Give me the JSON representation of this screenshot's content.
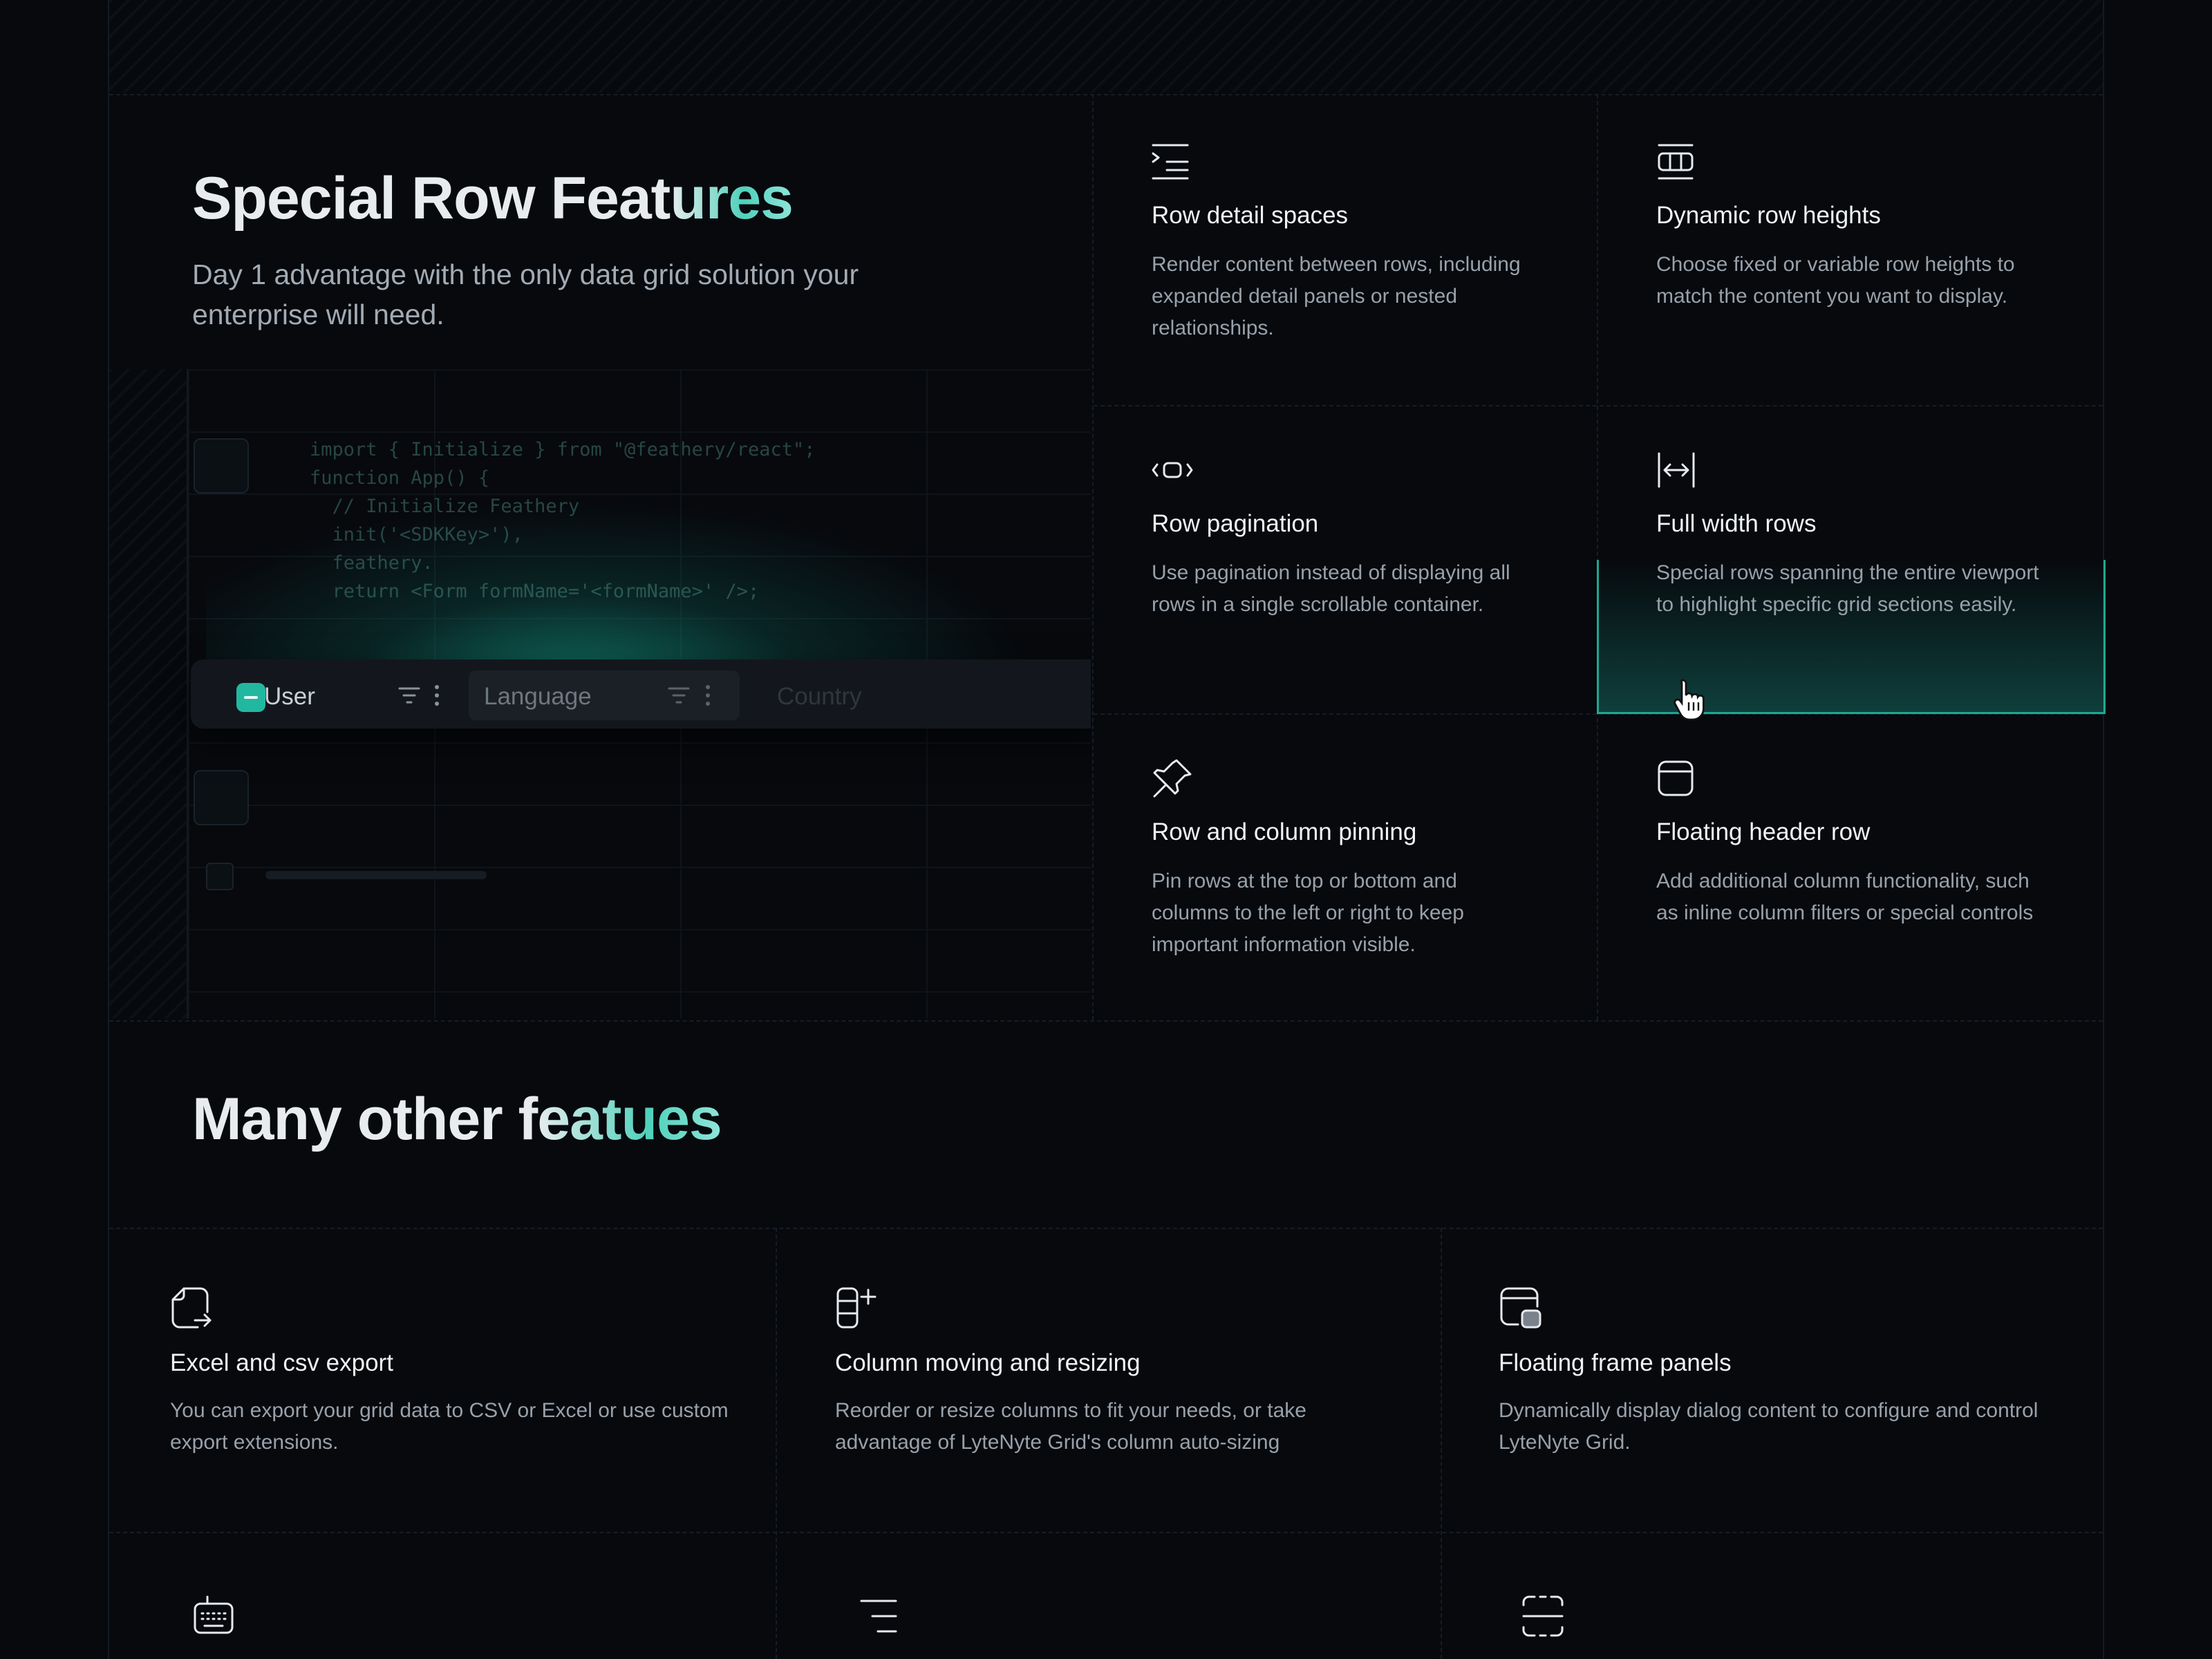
{
  "special": {
    "title_plain": "Special Row Feat",
    "title_accent": "ures",
    "subtitle": "Day 1 advantage with the only data grid solution your enterprise will need."
  },
  "demo": {
    "code_lines": [
      "import { Initialize } from \"@feathery/react\";",
      "",
      "function App() {",
      "  // Initialize Feathery",
      "  init('<SDKKey>'),",
      "  feathery.",
      "  return <Form formName='<formName>' />;"
    ],
    "columns": [
      "User",
      "Language",
      "Country"
    ]
  },
  "features": [
    {
      "icon": "row-detail-icon",
      "title": "Row detail spaces",
      "description": "Render content between rows, including expanded detail panels or nested relationships."
    },
    {
      "icon": "row-height-icon",
      "title": "Dynamic row heights",
      "description": "Choose fixed or variable row heights to match the content you want to display."
    },
    {
      "icon": "pagination-icon",
      "title": "Row pagination",
      "description": "Use pagination instead of displaying all rows in a single scrollable container."
    },
    {
      "icon": "full-width-icon",
      "title": "Full width rows",
      "description": "Special rows spanning the entire viewport to highlight specific grid sections easily."
    },
    {
      "icon": "pin-icon",
      "title": "Row and column pinning",
      "description": "Pin rows at the top or bottom and columns to the left or right to keep important information visible."
    },
    {
      "icon": "header-row-icon",
      "title": "Floating header row",
      "description": "Add additional column functionality, such as inline column filters or special controls"
    }
  ],
  "many": {
    "title_plain": "Many other f",
    "title_accent": "eatues"
  },
  "other_features": [
    {
      "icon": "export-icon",
      "title": "Excel and csv export",
      "description": "You can export your grid data to CSV or Excel or use custom export extensions."
    },
    {
      "icon": "column-add-icon",
      "title": "Column moving and resizing",
      "description": "Reorder or resize columns to fit your needs, or take advantage of LyteNyte Grid's column auto-sizing"
    },
    {
      "icon": "floating-panel-icon",
      "title": "Floating frame panels",
      "description": "Dynamically display dialog content to configure and control LyteNyte Grid."
    }
  ],
  "bottom_icons": [
    "keyboard-icon",
    "align-right-icon",
    "fit-frame-icon"
  ],
  "colors": {
    "accent": "#22b8a0",
    "background": "#07090d",
    "text": "#f1f4f6",
    "muted": "#98a1aa"
  }
}
